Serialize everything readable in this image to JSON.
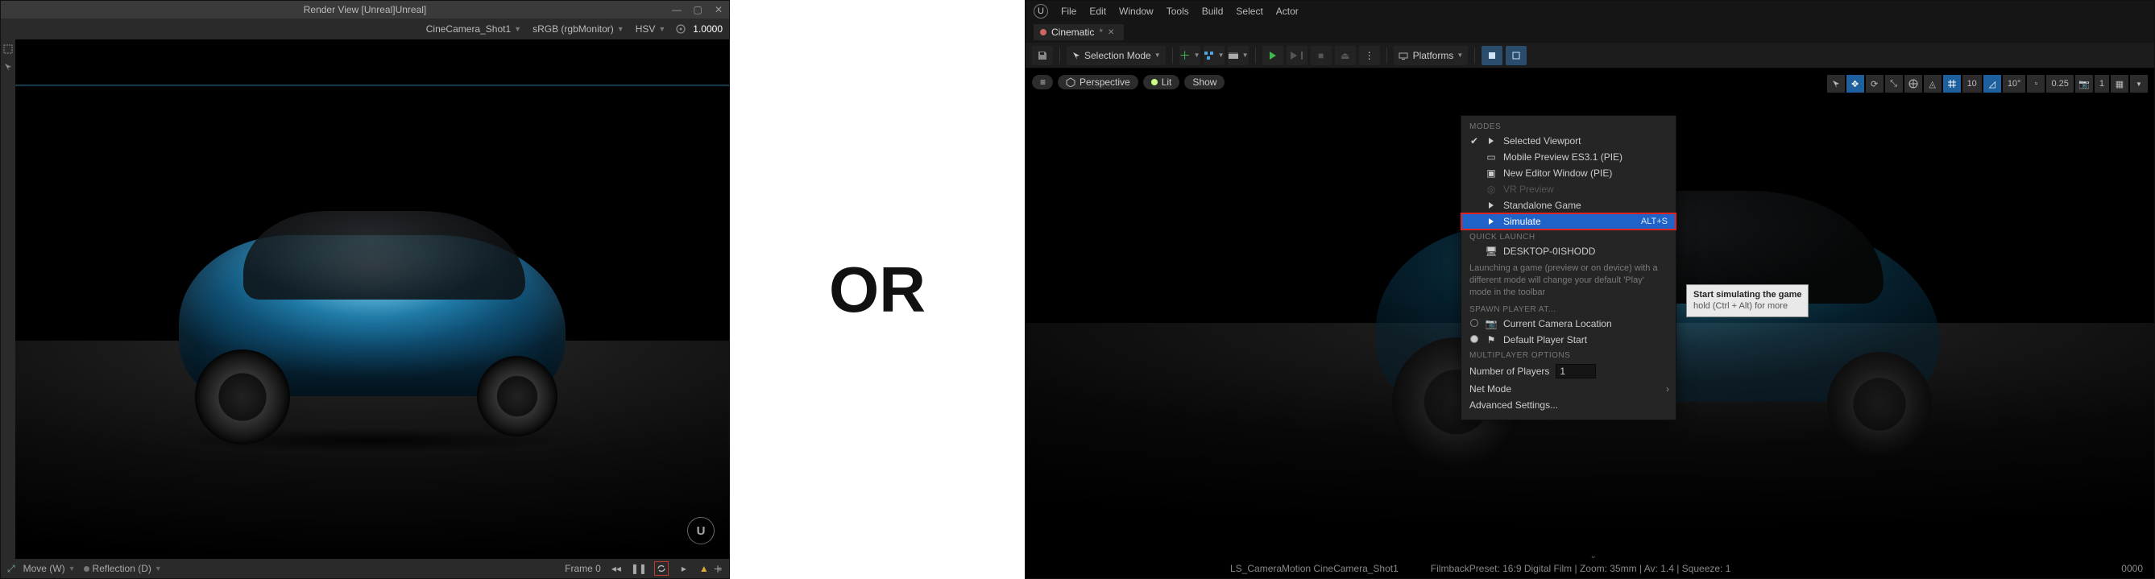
{
  "left": {
    "title": "Render View [Unreal]Unreal]",
    "toolbar": {
      "camera": "CineCamera_Shot1",
      "colorspace": "sRGB (rgbMonitor)",
      "mode": "HSV",
      "exposure": "1.0000"
    },
    "status": {
      "move": "Move (W)",
      "reflection": "Reflection (D)",
      "frame_label": "Frame 0"
    }
  },
  "center_label": "OR",
  "right": {
    "menu": [
      "File",
      "Edit",
      "Window",
      "Tools",
      "Build",
      "Select",
      "Actor"
    ],
    "tab": "Cinematic",
    "toolbar": {
      "selection_mode": "Selection Mode",
      "platforms": "Platforms"
    },
    "viewport_pills": {
      "perspective": "Perspective",
      "lit": "Lit",
      "show": "Show"
    },
    "viewport_right": {
      "val_a": "10",
      "val_b": "10°",
      "val_c": "0.25",
      "val_d": "1"
    },
    "play_menu": {
      "sections": {
        "modes": "MODES",
        "quick": "QUICK LAUNCH",
        "spawn": "SPAWN PLAYER AT...",
        "mp": "MULTIPLAYER OPTIONS"
      },
      "items": {
        "selected_viewport": "Selected Viewport",
        "mobile_preview": "Mobile Preview ES3.1 (PIE)",
        "new_editor_window": "New Editor Window (PIE)",
        "vr_preview": "VR Preview",
        "standalone": "Standalone Game",
        "simulate": "Simulate",
        "simulate_sc": "ALT+S",
        "desktop": "DESKTOP-0ISHODD",
        "help": "Launching a game (preview or on device) with a different mode will change your default 'Play' mode in the toolbar",
        "cur_cam": "Current Camera Location",
        "def_start": "Default Player Start",
        "num_players_label": "Number of Players",
        "num_players_value": "1",
        "net_mode": "Net Mode",
        "adv": "Advanced Settings..."
      },
      "tooltip_l1": "Start simulating the game",
      "tooltip_l2": "hold (Ctrl + Alt) for more"
    },
    "status": {
      "path": "LS_CameraMotion CineCamera_Shot1",
      "filmback": "FilmbackPreset: 16:9 Digital Film | Zoom: 35mm | Av: 1.4 | Squeeze: 1",
      "frame": "0000"
    }
  }
}
